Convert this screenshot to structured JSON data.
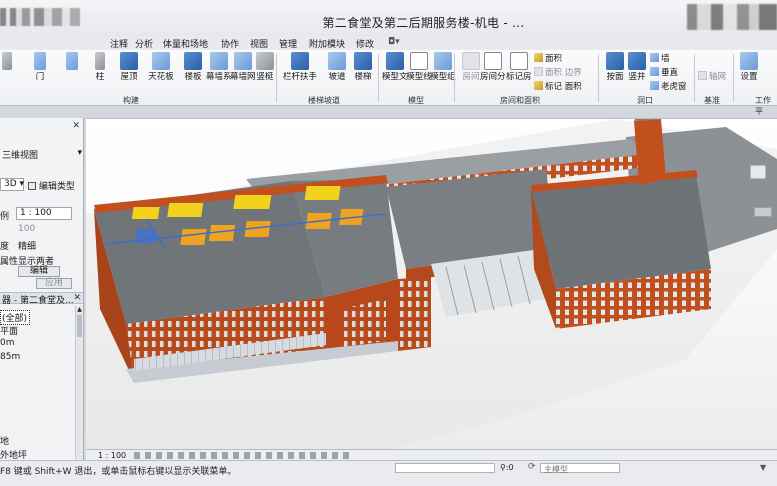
{
  "window": {
    "title": "第二食堂及第二后期服务楼-机电 - ..."
  },
  "menu": {
    "tabs": [
      "注释",
      "分析",
      "体量和场地",
      "协作",
      "视图",
      "管理",
      "附加模块",
      "修改"
    ]
  },
  "ribbon": {
    "partial_left": [
      "门",
      "柱"
    ],
    "buttons": [
      {
        "label": "屋顶",
        "icon": "roof-icon"
      },
      {
        "label": "天花板",
        "icon": "ceiling-icon"
      },
      {
        "label": "楼板",
        "icon": "floor-icon"
      },
      {
        "label": "幕墙系统",
        "icon": "curtain-system-icon"
      },
      {
        "label": "幕墙网格",
        "icon": "curtain-grid-icon"
      },
      {
        "label": "竖梃",
        "icon": "mullion-icon"
      },
      {
        "label": "栏杆扶手",
        "icon": "railing-icon"
      },
      {
        "label": "坡道",
        "icon": "ramp-icon"
      },
      {
        "label": "楼梯",
        "icon": "stair-icon"
      },
      {
        "label": "模型文字",
        "icon": "model-text-icon"
      },
      {
        "label": "模型线",
        "icon": "model-line-icon"
      },
      {
        "label": "模型组",
        "icon": "model-group-icon"
      },
      {
        "label": "房间",
        "icon": "room-icon"
      },
      {
        "label": "房间分隔",
        "icon": "room-separator-icon"
      },
      {
        "label": "标记房间",
        "icon": "tag-room-icon"
      },
      {
        "label": "按面",
        "icon": "by-face-icon"
      },
      {
        "label": "竖井",
        "icon": "shaft-icon"
      },
      {
        "label": "设置",
        "icon": "settings-icon"
      }
    ],
    "small_buttons": [
      {
        "label": "面积",
        "icon": "area-icon"
      },
      {
        "label": "面积 边界",
        "icon": "area-boundary-icon"
      },
      {
        "label": "标记 面积",
        "icon": "tag-area-icon"
      },
      {
        "label": "墙",
        "icon": "wall-opening-icon"
      },
      {
        "label": "垂直",
        "icon": "vertical-opening-icon"
      },
      {
        "label": "老虎窗",
        "icon": "dormer-icon"
      },
      {
        "label": "轴网",
        "icon": "grid-icon"
      }
    ],
    "groups": [
      "构建",
      "楼梯坡道",
      "模型",
      "房间和面积",
      "洞口",
      "基准",
      "工作平"
    ]
  },
  "left_panel": {
    "view_type": "三维视图",
    "view_name": "3D",
    "edit_type": "编辑类型",
    "scale_label": "例",
    "scale_value": "1 : 100",
    "scale_value2": "100",
    "detail_label": "度",
    "detail_value": "精细",
    "parts_label": "属性",
    "parts_value": "显示两者",
    "edit_button": "编辑",
    "apply_button": "应用",
    "browser_title": "器 - 第二食堂及...",
    "tree": [
      "(全部)",
      "平面",
      "0m",
      "85m",
      "地",
      "外地坪"
    ]
  },
  "viewbar": {
    "scale": "1 : 100"
  },
  "status": {
    "text": "F8 键或 Shift+W 退出，或单击鼠标右键以显示关联菜单。",
    "zero": ":0",
    "model": "主模型"
  },
  "colors": {
    "brick": "#c2501f",
    "roof": "#6f7478",
    "glass": "#cfd6dc",
    "equipment_yellow": "#f2d21c",
    "equipment_orange": "#f0a321"
  }
}
